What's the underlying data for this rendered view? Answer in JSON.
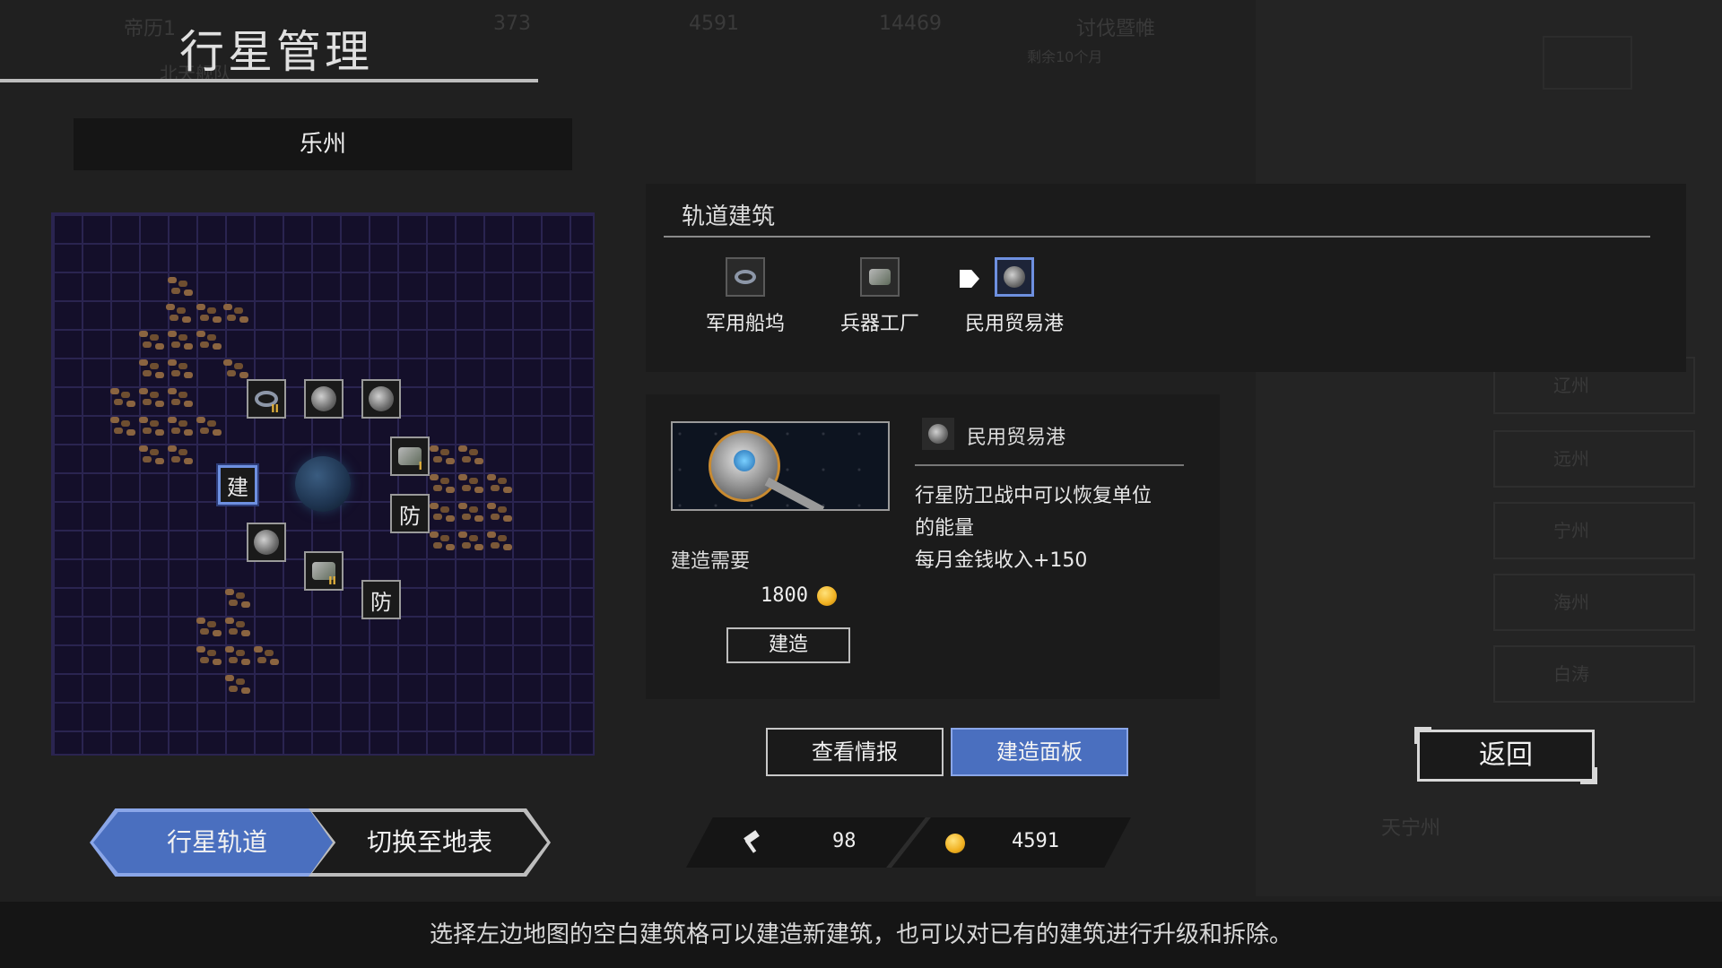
{
  "page": {
    "title": "行星管理",
    "planet_name": "乐州"
  },
  "background": {
    "top_items": [
      "帝历1",
      "373",
      "4591",
      "14469",
      "讨伐暨帷",
      "北天舰队",
      "剩余10个月"
    ],
    "side_list": [
      "辽州",
      "远州",
      "宁州",
      "海州",
      "白涛"
    ],
    "map_label": "天宁州"
  },
  "map": {
    "cells": [
      {
        "kind": "empty",
        "label": "建",
        "selected": true
      },
      {
        "kind": "defense",
        "label": "防"
      },
      {
        "kind": "defense",
        "label": "防"
      },
      {
        "kind": "shipyard",
        "tier": "II"
      },
      {
        "kind": "factory",
        "tier": "I"
      },
      {
        "kind": "factory",
        "tier": "II"
      }
    ]
  },
  "orbital": {
    "title": "轨道建筑",
    "options": [
      {
        "label": "军用船坞",
        "icon": "shipyard-icon",
        "active": false
      },
      {
        "label": "兵器工厂",
        "icon": "factory-icon",
        "active": false
      },
      {
        "label": "民用贸易港",
        "icon": "trade-port-icon",
        "active": true
      }
    ]
  },
  "detail": {
    "name": "民用贸易港",
    "requirement_label": "建造需要",
    "cost": "1800",
    "build_button": "建造",
    "description_lines": [
      "行星防卫战中可以恢复单位",
      "的能量",
      "每月金钱收入+150"
    ]
  },
  "actions": {
    "info_button": "查看情报",
    "build_panel_button": "建造面板",
    "back_button": "返回"
  },
  "resources": {
    "production": "98",
    "money": "4591"
  },
  "view_toggle": {
    "orbit_tab": "行星轨道",
    "surface_tab": "切换至地表"
  },
  "hint": "选择左边地图的空白建筑格可以建造新建筑，也可以对已有的建筑进行升级和拆除。",
  "colors": {
    "accent_blue": "#4a6fbf",
    "coin_gold": "#f0b020",
    "panel_bg": "#1b1b1b"
  }
}
